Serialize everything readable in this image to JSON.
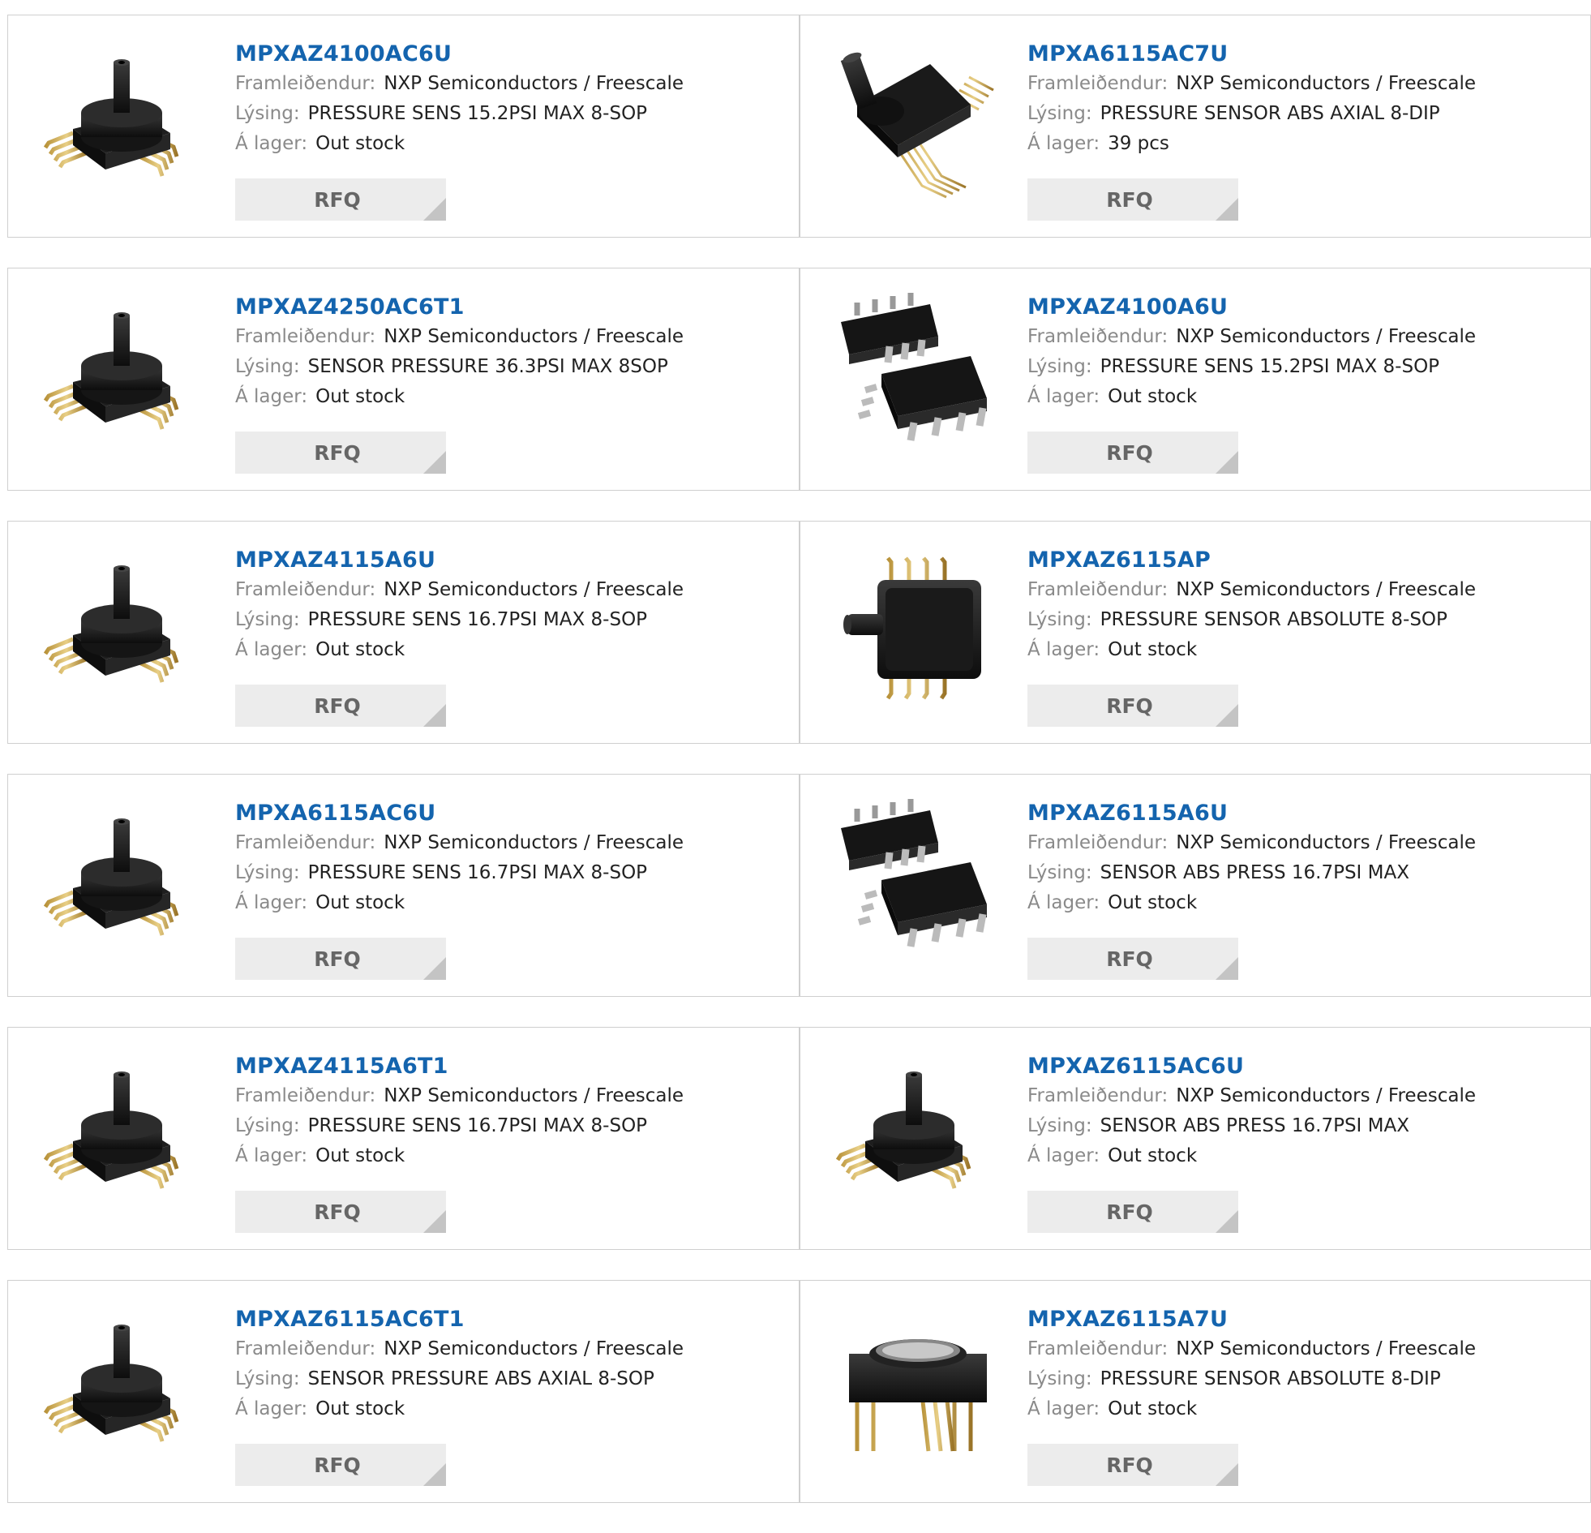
{
  "labels": {
    "manufacturer": "Framleiðendur:",
    "description": "Lýsing:",
    "stock": "Á lager:",
    "rfq": "RFQ"
  },
  "products": [
    {
      "pn": "MPXAZ4100AC6U",
      "manufacturer": "NXP Semiconductors / Freescale",
      "description": "PRESSURE SENS 15.2PSI MAX 8-SOP",
      "stock": "Out stock",
      "image": "pressure-sensor-sop-port-icon"
    },
    {
      "pn": "MPXA6115AC7U",
      "manufacturer": "NXP Semiconductors / Freescale",
      "description": "PRESSURE SENSOR ABS AXIAL 8-DIP",
      "stock": "39 pcs",
      "image": "pressure-sensor-axial-dip-icon"
    },
    {
      "pn": "MPXAZ4250AC6T1",
      "manufacturer": "NXP Semiconductors / Freescale",
      "description": "SENSOR PRESSURE 36.3PSI MAX 8SOP",
      "stock": "Out stock",
      "image": "pressure-sensor-sop-port-icon"
    },
    {
      "pn": "MPXAZ4100A6U",
      "manufacturer": "NXP Semiconductors / Freescale",
      "description": "PRESSURE SENS 15.2PSI MAX 8-SOP",
      "stock": "Out stock",
      "image": "soic-chip-pair-icon"
    },
    {
      "pn": "MPXAZ4115A6U",
      "manufacturer": "NXP Semiconductors / Freescale",
      "description": "PRESSURE SENS 16.7PSI MAX 8-SOP",
      "stock": "Out stock",
      "image": "pressure-sensor-sop-port-icon"
    },
    {
      "pn": "MPXAZ6115AP",
      "manufacturer": "NXP Semiconductors / Freescale",
      "description": "PRESSURE SENSOR ABSOLUTE 8-SOP",
      "stock": "Out stock",
      "image": "pressure-sensor-side-port-icon"
    },
    {
      "pn": "MPXA6115AC6U",
      "manufacturer": "NXP Semiconductors / Freescale",
      "description": "PRESSURE SENS 16.7PSI MAX 8-SOP",
      "stock": "Out stock",
      "image": "pressure-sensor-sop-port-icon"
    },
    {
      "pn": "MPXAZ6115A6U",
      "manufacturer": "NXP Semiconductors / Freescale",
      "description": "SENSOR ABS PRESS 16.7PSI MAX",
      "stock": "Out stock",
      "image": "soic-chip-pair-icon"
    },
    {
      "pn": "MPXAZ4115A6T1",
      "manufacturer": "NXP Semiconductors / Freescale",
      "description": "PRESSURE SENS 16.7PSI MAX 8-SOP",
      "stock": "Out stock",
      "image": "pressure-sensor-sop-port-icon"
    },
    {
      "pn": "MPXAZ6115AC6U",
      "manufacturer": "NXP Semiconductors / Freescale",
      "description": "SENSOR ABS PRESS 16.7PSI MAX",
      "stock": "Out stock",
      "image": "pressure-sensor-sop-port-icon"
    },
    {
      "pn": "MPXAZ6115AC6T1",
      "manufacturer": "NXP Semiconductors / Freescale",
      "description": "SENSOR PRESSURE ABS AXIAL 8-SOP",
      "stock": "Out stock",
      "image": "pressure-sensor-sop-port-icon"
    },
    {
      "pn": "MPXAZ6115A7U",
      "manufacturer": "NXP Semiconductors / Freescale",
      "description": "PRESSURE SENSOR ABSOLUTE 8-DIP",
      "stock": "Out stock",
      "image": "pressure-sensor-dip-icon"
    }
  ]
}
